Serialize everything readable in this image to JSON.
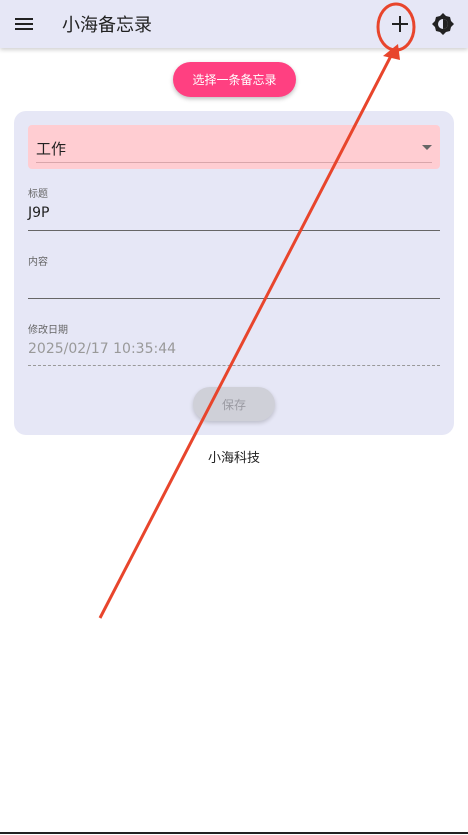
{
  "appbar": {
    "title": "小海备忘录",
    "icons": {
      "menu": "menu-icon",
      "add": "plus-icon",
      "theme": "theme-toggle-icon"
    }
  },
  "select_memo_button": {
    "label": "选择一条备忘录"
  },
  "form": {
    "category": {
      "value": "工作"
    },
    "title": {
      "label": "标题",
      "value": "J9P"
    },
    "content": {
      "label": "内容",
      "value": ""
    },
    "modified": {
      "label": "修改日期",
      "value": "2025/02/17 10:35:44"
    },
    "save_label": "保存"
  },
  "footer": {
    "text": "小海科技"
  },
  "colors": {
    "appbar_bg": "#e6e7f6",
    "accent_pink": "#ff4081",
    "category_bg": "#ffcdd2",
    "annotation_red": "#e8452c"
  }
}
